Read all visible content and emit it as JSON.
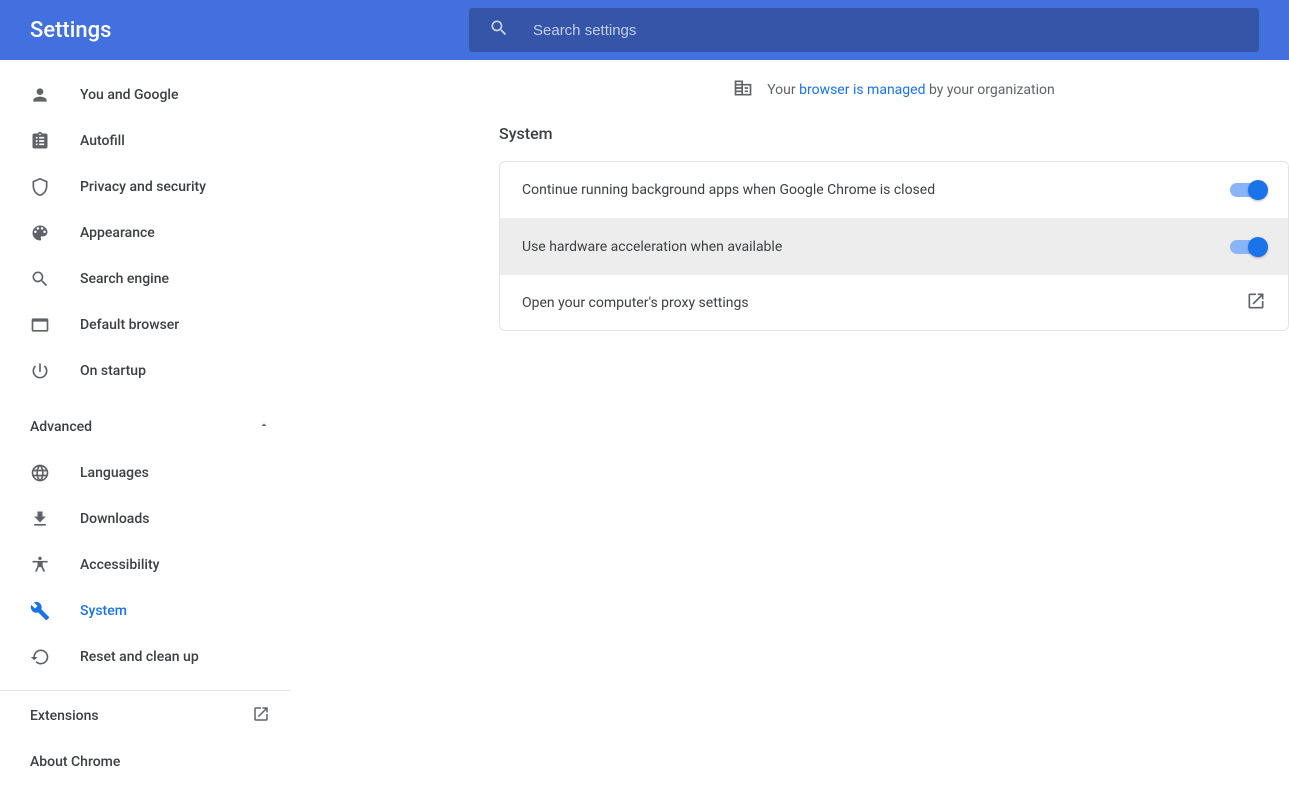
{
  "header": {
    "title": "Settings",
    "search_placeholder": "Search settings"
  },
  "sidebar": {
    "items": [
      {
        "id": "you-and-google",
        "label": "You and Google",
        "icon": "person"
      },
      {
        "id": "autofill",
        "label": "Autofill",
        "icon": "clipboard"
      },
      {
        "id": "privacy",
        "label": "Privacy and security",
        "icon": "shield"
      },
      {
        "id": "appearance",
        "label": "Appearance",
        "icon": "palette"
      },
      {
        "id": "search-engine",
        "label": "Search engine",
        "icon": "search"
      },
      {
        "id": "default-browser",
        "label": "Default browser",
        "icon": "browser"
      },
      {
        "id": "on-startup",
        "label": "On startup",
        "icon": "power"
      }
    ],
    "advanced_label": "Advanced",
    "advanced_expanded": true,
    "advanced_items": [
      {
        "id": "languages",
        "label": "Languages",
        "icon": "globe"
      },
      {
        "id": "downloads",
        "label": "Downloads",
        "icon": "download"
      },
      {
        "id": "accessibility",
        "label": "Accessibility",
        "icon": "accessibility"
      },
      {
        "id": "system",
        "label": "System",
        "icon": "wrench",
        "selected": true
      },
      {
        "id": "reset",
        "label": "Reset and clean up",
        "icon": "restore"
      }
    ],
    "extensions_label": "Extensions",
    "about_label": "About Chrome"
  },
  "managed": {
    "prefix": "Your ",
    "link": "browser is managed",
    "suffix": " by your organization"
  },
  "section": {
    "title": "System",
    "rows": [
      {
        "label": "Continue running background apps when Google Chrome is closed",
        "type": "toggle",
        "on": true
      },
      {
        "label": "Use hardware acceleration when available",
        "type": "toggle",
        "on": true,
        "hover": true
      },
      {
        "label": "Open your computer's proxy settings",
        "type": "link"
      }
    ]
  }
}
